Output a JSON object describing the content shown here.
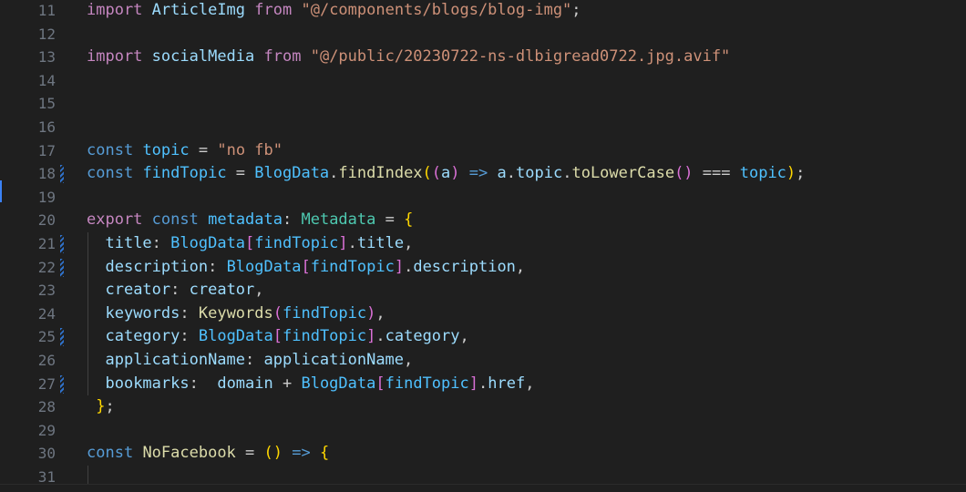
{
  "editor": {
    "lines": [
      {
        "num": "11",
        "modified": false,
        "tokens": [
          {
            "t": "import",
            "c": "kw2"
          },
          {
            "t": " "
          },
          {
            "t": "ArticleImg",
            "c": "var"
          },
          {
            "t": " "
          },
          {
            "t": "from",
            "c": "kw2"
          },
          {
            "t": " "
          },
          {
            "t": "\"@/components/blogs/blog-img\"",
            "c": "str"
          },
          {
            "t": ";"
          }
        ]
      },
      {
        "num": "12",
        "modified": false,
        "tokens": []
      },
      {
        "num": "13",
        "modified": false,
        "tokens": [
          {
            "t": "import",
            "c": "kw2"
          },
          {
            "t": " "
          },
          {
            "t": "socialMedia",
            "c": "var"
          },
          {
            "t": " "
          },
          {
            "t": "from",
            "c": "kw2"
          },
          {
            "t": " "
          },
          {
            "t": "\"@/public/20230722-ns-dlbigread0722.jpg.avif\"",
            "c": "str"
          }
        ]
      },
      {
        "num": "14",
        "modified": false,
        "tokens": []
      },
      {
        "num": "15",
        "modified": false,
        "tokens": []
      },
      {
        "num": "16",
        "modified": false,
        "tokens": []
      },
      {
        "num": "17",
        "modified": false,
        "tokens": [
          {
            "t": "const",
            "c": "kw"
          },
          {
            "t": " "
          },
          {
            "t": "topic",
            "c": "con"
          },
          {
            "t": " = "
          },
          {
            "t": "\"no fb\"",
            "c": "str"
          }
        ]
      },
      {
        "num": "18",
        "modified": true,
        "tokens": [
          {
            "t": "const",
            "c": "kw"
          },
          {
            "t": " "
          },
          {
            "t": "findTopic",
            "c": "con"
          },
          {
            "t": " = "
          },
          {
            "t": "BlogData",
            "c": "con"
          },
          {
            "t": "."
          },
          {
            "t": "findIndex",
            "c": "fn"
          },
          {
            "t": "(",
            "c": "br1"
          },
          {
            "t": "(",
            "c": "br2"
          },
          {
            "t": "a",
            "c": "var"
          },
          {
            "t": ")",
            "c": "br2"
          },
          {
            "t": " "
          },
          {
            "t": "=>",
            "c": "kw"
          },
          {
            "t": " "
          },
          {
            "t": "a",
            "c": "var"
          },
          {
            "t": "."
          },
          {
            "t": "topic",
            "c": "var"
          },
          {
            "t": "."
          },
          {
            "t": "toLowerCase",
            "c": "fn"
          },
          {
            "t": "()",
            "c": "br2"
          },
          {
            "t": " === "
          },
          {
            "t": "topic",
            "c": "con"
          },
          {
            "t": ")",
            "c": "br1"
          },
          {
            "t": ";"
          }
        ]
      },
      {
        "num": "19",
        "modified": false,
        "tokens": []
      },
      {
        "num": "20",
        "modified": false,
        "tokens": [
          {
            "t": "export",
            "c": "kw2"
          },
          {
            "t": " "
          },
          {
            "t": "const",
            "c": "kw"
          },
          {
            "t": " "
          },
          {
            "t": "metadata",
            "c": "con"
          },
          {
            "t": ": "
          },
          {
            "t": "Metadata",
            "c": "typ"
          },
          {
            "t": " = "
          },
          {
            "t": "{",
            "c": "br1"
          }
        ]
      },
      {
        "num": "21",
        "modified": true,
        "indent": true,
        "tokens": [
          {
            "t": "  "
          },
          {
            "t": "title",
            "c": "var"
          },
          {
            "t": ": "
          },
          {
            "t": "BlogData",
            "c": "con"
          },
          {
            "t": "[",
            "c": "br2"
          },
          {
            "t": "findTopic",
            "c": "con"
          },
          {
            "t": "]",
            "c": "br2"
          },
          {
            "t": "."
          },
          {
            "t": "title",
            "c": "var"
          },
          {
            "t": ","
          }
        ]
      },
      {
        "num": "22",
        "modified": true,
        "indent": true,
        "tokens": [
          {
            "t": "  "
          },
          {
            "t": "description",
            "c": "var"
          },
          {
            "t": ": "
          },
          {
            "t": "BlogData",
            "c": "con"
          },
          {
            "t": "[",
            "c": "br2"
          },
          {
            "t": "findTopic",
            "c": "con"
          },
          {
            "t": "]",
            "c": "br2"
          },
          {
            "t": "."
          },
          {
            "t": "description",
            "c": "var"
          },
          {
            "t": ","
          }
        ]
      },
      {
        "num": "23",
        "modified": false,
        "indent": true,
        "tokens": [
          {
            "t": "  "
          },
          {
            "t": "creator",
            "c": "var"
          },
          {
            "t": ": "
          },
          {
            "t": "creator",
            "c": "var"
          },
          {
            "t": ","
          }
        ]
      },
      {
        "num": "24",
        "modified": false,
        "indent": true,
        "tokens": [
          {
            "t": "  "
          },
          {
            "t": "keywords",
            "c": "var"
          },
          {
            "t": ": "
          },
          {
            "t": "Keywords",
            "c": "fn"
          },
          {
            "t": "(",
            "c": "br2"
          },
          {
            "t": "findTopic",
            "c": "con"
          },
          {
            "t": ")",
            "c": "br2"
          },
          {
            "t": ","
          }
        ]
      },
      {
        "num": "25",
        "modified": true,
        "indent": true,
        "tokens": [
          {
            "t": "  "
          },
          {
            "t": "category",
            "c": "var"
          },
          {
            "t": ": "
          },
          {
            "t": "BlogData",
            "c": "con"
          },
          {
            "t": "[",
            "c": "br2"
          },
          {
            "t": "findTopic",
            "c": "con"
          },
          {
            "t": "]",
            "c": "br2"
          },
          {
            "t": "."
          },
          {
            "t": "category",
            "c": "var"
          },
          {
            "t": ","
          }
        ]
      },
      {
        "num": "26",
        "modified": false,
        "indent": true,
        "tokens": [
          {
            "t": "  "
          },
          {
            "t": "applicationName",
            "c": "var"
          },
          {
            "t": ": "
          },
          {
            "t": "applicationName",
            "c": "var"
          },
          {
            "t": ","
          }
        ]
      },
      {
        "num": "27",
        "modified": true,
        "indent": true,
        "tokens": [
          {
            "t": "  "
          },
          {
            "t": "bookmarks",
            "c": "var"
          },
          {
            "t": ":  "
          },
          {
            "t": "domain",
            "c": "var"
          },
          {
            "t": " + "
          },
          {
            "t": "BlogData",
            "c": "con"
          },
          {
            "t": "[",
            "c": "br2"
          },
          {
            "t": "findTopic",
            "c": "con"
          },
          {
            "t": "]",
            "c": "br2"
          },
          {
            "t": "."
          },
          {
            "t": "href",
            "c": "var"
          },
          {
            "t": ","
          }
        ]
      },
      {
        "num": "28",
        "modified": false,
        "tokens": [
          {
            "t": " "
          },
          {
            "t": "}",
            "c": "br1"
          },
          {
            "t": ";"
          }
        ]
      },
      {
        "num": "29",
        "modified": false,
        "tokens": []
      },
      {
        "num": "30",
        "modified": false,
        "tokens": [
          {
            "t": "const",
            "c": "kw"
          },
          {
            "t": " "
          },
          {
            "t": "NoFacebook",
            "c": "fn"
          },
          {
            "t": " = "
          },
          {
            "t": "()",
            "c": "br1"
          },
          {
            "t": " "
          },
          {
            "t": "=>",
            "c": "kw"
          },
          {
            "t": " "
          },
          {
            "t": "{",
            "c": "br1"
          }
        ]
      },
      {
        "num": "31",
        "modified": false,
        "indent": true,
        "tokens": []
      }
    ]
  }
}
